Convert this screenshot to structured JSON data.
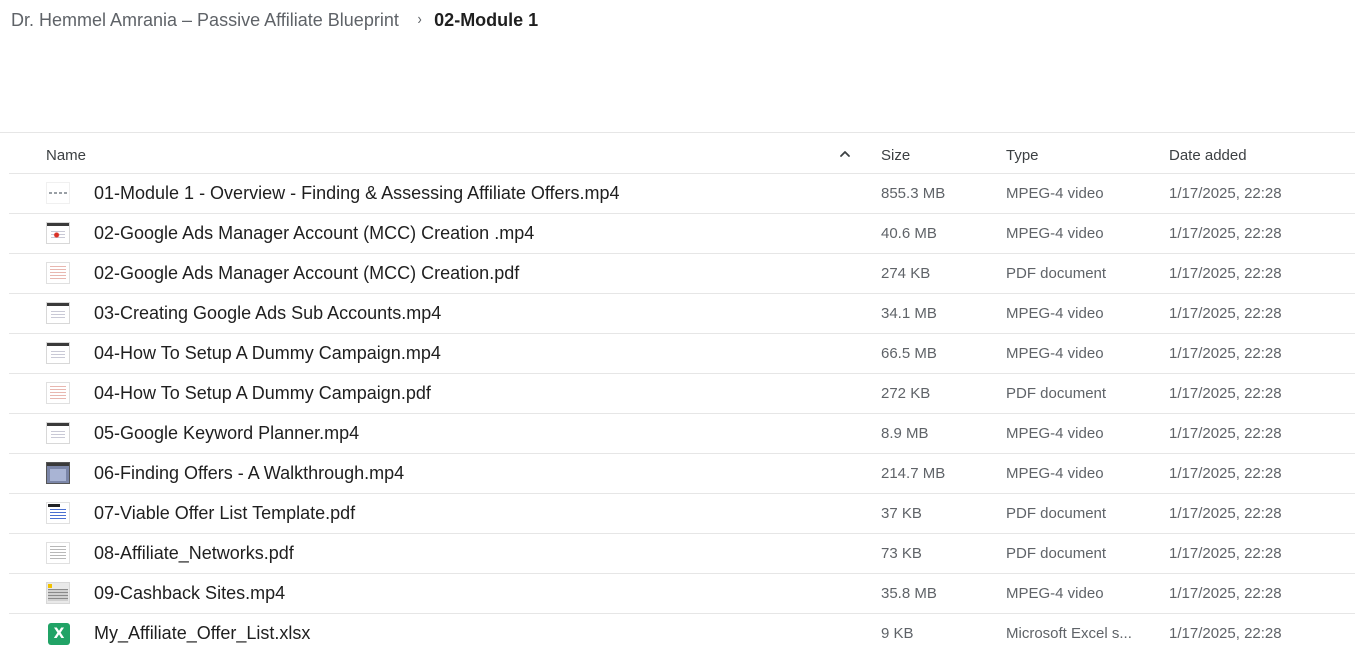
{
  "breadcrumb": {
    "parent": "Dr. Hemmel Amrania – Passive Affiliate Blueprint",
    "separator": "›",
    "current": "02-Module 1"
  },
  "columns": {
    "name": "Name",
    "size": "Size",
    "type": "Type",
    "date": "Date added"
  },
  "sort": {
    "column": "name",
    "direction": "ascending",
    "icon": "chevron-up-icon"
  },
  "files": [
    {
      "name": "01-Module 1 - Overview - Finding & Assessing Affiliate Offers.mp4",
      "size": "855.3 MB",
      "type": "MPEG-4 video",
      "date": "1/17/2025, 22:28",
      "icon": "video-thumbnail"
    },
    {
      "name": "02-Google Ads Manager Account (MCC) Creation .mp4",
      "size": "40.6 MB",
      "type": "MPEG-4 video",
      "date": "1/17/2025, 22:28",
      "icon": "video-thumbnail"
    },
    {
      "name": "02-Google Ads Manager Account (MCC) Creation.pdf",
      "size": "274 KB",
      "type": "PDF document",
      "date": "1/17/2025, 22:28",
      "icon": "pdf-thumbnail"
    },
    {
      "name": "03-Creating Google Ads Sub Accounts.mp4",
      "size": "34.1 MB",
      "type": "MPEG-4 video",
      "date": "1/17/2025, 22:28",
      "icon": "video-thumbnail"
    },
    {
      "name": "04-How To Setup A Dummy Campaign.mp4",
      "size": "66.5 MB",
      "type": "MPEG-4 video",
      "date": "1/17/2025, 22:28",
      "icon": "video-thumbnail"
    },
    {
      "name": "04-How To Setup A Dummy Campaign.pdf",
      "size": "272 KB",
      "type": "PDF document",
      "date": "1/17/2025, 22:28",
      "icon": "pdf-thumbnail"
    },
    {
      "name": "05-Google Keyword Planner.mp4",
      "size": "8.9 MB",
      "type": "MPEG-4 video",
      "date": "1/17/2025, 22:28",
      "icon": "video-thumbnail"
    },
    {
      "name": "06-Finding Offers - A Walkthrough.mp4",
      "size": "214.7 MB",
      "type": "MPEG-4 video",
      "date": "1/17/2025, 22:28",
      "icon": "video-thumbnail"
    },
    {
      "name": "07-Viable Offer List Template.pdf",
      "size": "37 KB",
      "type": "PDF document",
      "date": "1/17/2025, 22:28",
      "icon": "pdf-thumbnail"
    },
    {
      "name": "08-Affiliate_Networks.pdf",
      "size": "73 KB",
      "type": "PDF document",
      "date": "1/17/2025, 22:28",
      "icon": "pdf-thumbnail"
    },
    {
      "name": "09-Cashback Sites.mp4",
      "size": "35.8 MB",
      "type": "MPEG-4 video",
      "date": "1/17/2025, 22:28",
      "icon": "video-thumbnail"
    },
    {
      "name": "My_Affiliate_Offer_List.xlsx",
      "size": "9 KB",
      "type": "Microsoft Excel s...",
      "date": "1/17/2025, 22:28",
      "icon": "excel-icon",
      "icon_glyph": "X"
    }
  ]
}
